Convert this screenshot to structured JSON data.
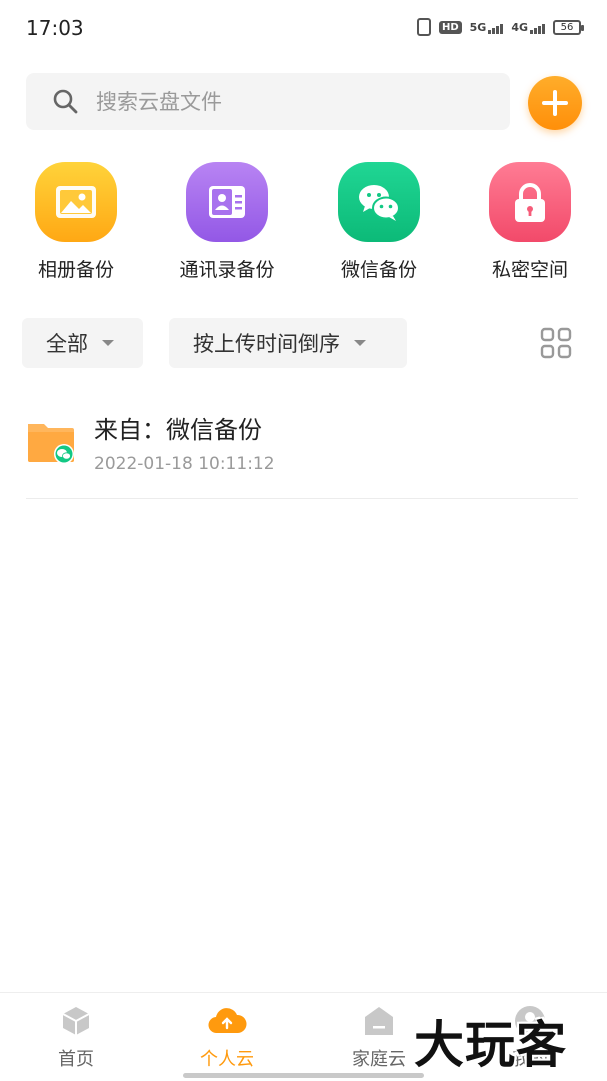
{
  "status_bar": {
    "time": "17:03",
    "hd_label": "HD",
    "net1": "5G",
    "net2": "4G",
    "battery": "56"
  },
  "search": {
    "placeholder": "搜索云盘文件"
  },
  "quick_access": [
    {
      "label": "相册备份",
      "icon": "album-icon"
    },
    {
      "label": "通讯录备份",
      "icon": "contact-card-icon"
    },
    {
      "label": "微信备份",
      "icon": "wechat-icon"
    },
    {
      "label": "私密空间",
      "icon": "lock-icon"
    }
  ],
  "filters": {
    "type_label": "全部",
    "sort_label": "按上传时间倒序"
  },
  "files": [
    {
      "name": "来自：微信备份",
      "time": "2022-01-18 10:11:12"
    }
  ],
  "bottom_nav": [
    {
      "label": "首页"
    },
    {
      "label": "个人云"
    },
    {
      "label": "家庭云"
    },
    {
      "label": "我的"
    }
  ],
  "watermark": "大玩客",
  "colors": {
    "accent": "#ff9a0e",
    "album": "#ffc11f",
    "contact": "#a56cec",
    "wechat": "#12c884",
    "private": "#f65c79"
  }
}
